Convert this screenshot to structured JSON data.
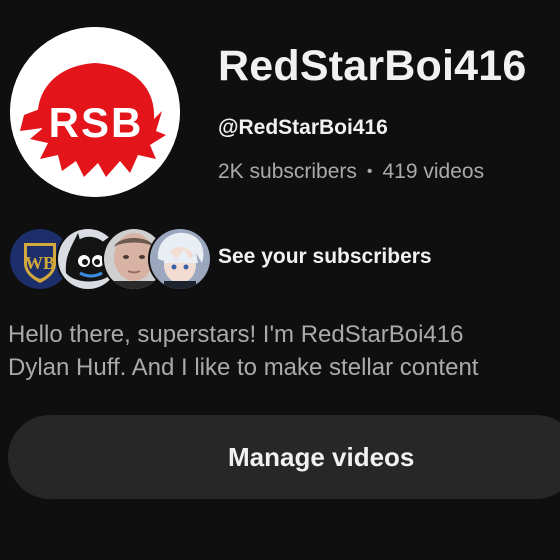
{
  "channel": {
    "name": "RedStarBoi416",
    "handle": "@RedStarBoi416",
    "subscribers": "2K subscribers",
    "separator": "•",
    "videos": "419 videos",
    "avatar_text": "RSB"
  },
  "subscribers_preview": {
    "label": "See your subscribers",
    "avatars": [
      "wb-logo-avatar",
      "cartoon-avatar",
      "person-avatar",
      "anime-avatar"
    ],
    "wb_text": "WB"
  },
  "description": {
    "line1": "Hello there, superstars! I'm RedStarBoi416",
    "line2": "Dylan Huff. And I like to make stellar content"
  },
  "actions": {
    "manage_videos": "Manage videos"
  },
  "colors": {
    "background": "#0f0f0f",
    "button": "#272727",
    "brand_red": "#e4141b",
    "secondary_text": "#aaaaaa"
  }
}
